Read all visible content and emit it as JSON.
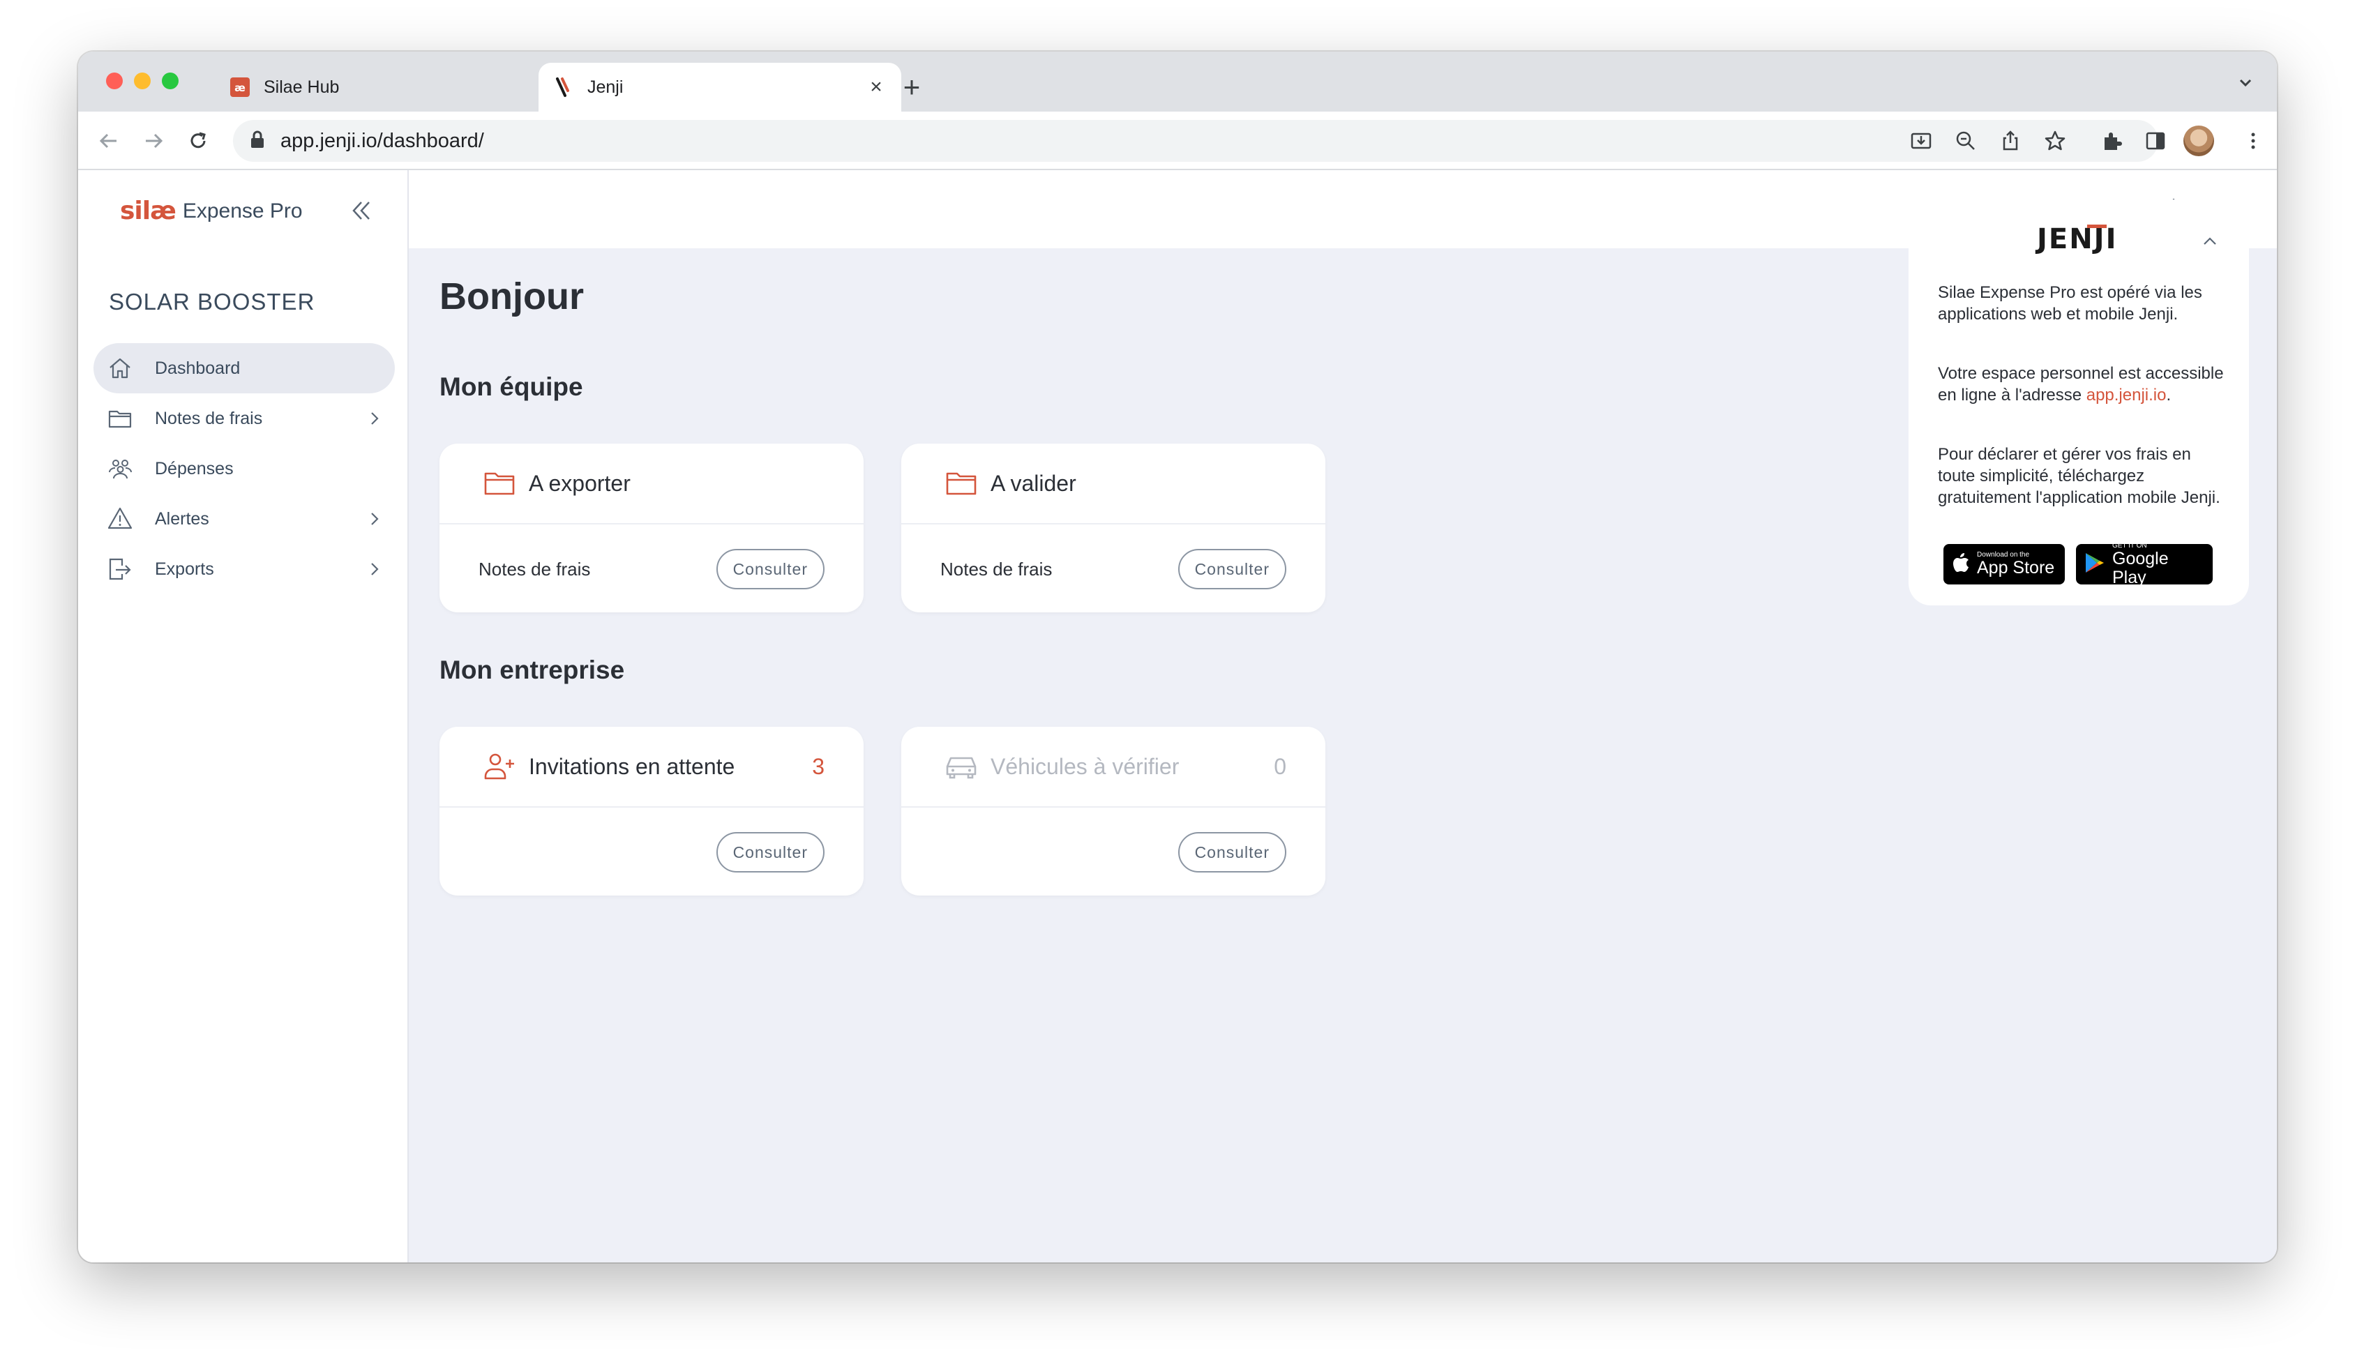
{
  "browser": {
    "tabs": [
      {
        "title": "Silae Hub",
        "active": false
      },
      {
        "title": "Jenji",
        "active": true
      }
    ],
    "address": "app.jenji.io/dashboard/"
  },
  "sidebar": {
    "logo_mark": "silæ",
    "logo_product": "Expense Pro",
    "company": "SOLAR BOOSTER",
    "items": [
      {
        "label": "Dashboard",
        "icon": "home-icon",
        "active": true,
        "has_children": false
      },
      {
        "label": "Notes de frais",
        "icon": "folder-icon",
        "active": false,
        "has_children": true
      },
      {
        "label": "Dépenses",
        "icon": "users-icon",
        "active": false,
        "has_children": false
      },
      {
        "label": "Alertes",
        "icon": "warning-icon",
        "active": false,
        "has_children": true
      },
      {
        "label": "Exports",
        "icon": "export-icon",
        "active": false,
        "has_children": true
      }
    ]
  },
  "main": {
    "greeting": "Bonjour",
    "team_section": "Mon équipe",
    "company_section": "Mon entreprise",
    "team_cards": [
      {
        "title": "A exporter",
        "label": "Notes de frais",
        "button": "Consulter"
      },
      {
        "title": "A valider",
        "label": "Notes de frais",
        "button": "Consulter"
      }
    ],
    "company_cards": [
      {
        "title": "Invitations en attente",
        "count": "3",
        "button": "Consulter"
      },
      {
        "title": "Véhicules à vérifier",
        "count": "0",
        "button": "Consulter"
      }
    ]
  },
  "panel": {
    "logo": "JENJI",
    "para1": "Silae Expense Pro est opéré via les applications web et mobile Jenji.",
    "para2_prefix": "Votre espace personnel est accessible en ligne à l'adresse ",
    "para2_link": "app.jenji.io",
    "para2_suffix": ".",
    "para3": "Pour déclarer et gérer vos frais en toute simplicité, téléchargez gratuitement l'application mobile Jenji.",
    "appstore_small": "Download on the",
    "appstore_big": "App Store",
    "googleplay_small": "GET IT ON",
    "googleplay_big": "Google Play"
  },
  "colors": {
    "accent": "#d4553c",
    "text": "#2b2f36",
    "background": "#eef0f7"
  }
}
